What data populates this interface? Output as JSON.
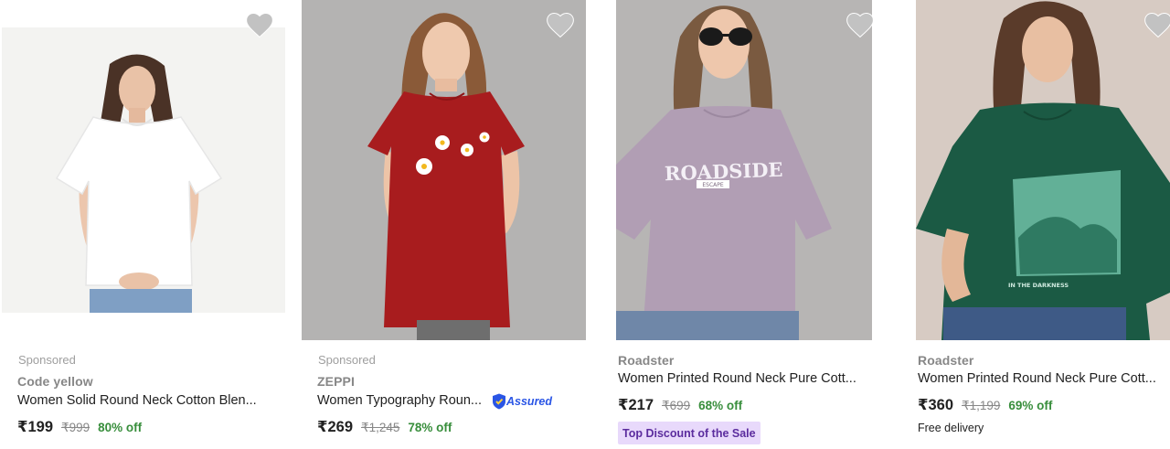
{
  "colors": {
    "discount_green": "#388e3c",
    "strike_grey": "#878787",
    "deal_bg": "#e8d9fb",
    "deal_text": "#5b2c9e",
    "assured_blue": "#2a55e5",
    "heart_grey": "#c2c2c2"
  },
  "products": [
    {
      "image": "white-tshirt-photo",
      "sponsored": "Sponsored",
      "brand": "Code yellow",
      "title": "Women Solid Round Neck Cotton Blen...",
      "price": "₹199",
      "mrp": "₹999",
      "off": "80% off",
      "wishlist_icon": "heart-icon"
    },
    {
      "image": "maroon-daisy-tshirt-photo",
      "sponsored": "Sponsored",
      "brand": "ZEPPI",
      "title": "Women Typography Roun...",
      "assured": "Assured",
      "price": "₹269",
      "mrp": "₹1,245",
      "off": "78% off",
      "wishlist_icon": "heart-icon"
    },
    {
      "image": "lavender-roadside-tshirt-photo",
      "brand": "Roadster",
      "title": "Women Printed Round Neck Pure Cott...",
      "price": "₹217",
      "mrp": "₹699",
      "off": "68% off",
      "badge": "Top Discount of the Sale",
      "print_text": "ROADSIDE",
      "print_sub": "ESCAPE",
      "wishlist_icon": "heart-icon"
    },
    {
      "image": "green-graphic-tshirt-photo",
      "brand": "Roadster",
      "title": "Women Printed Round Neck Pure Cott...",
      "price": "₹360",
      "mrp": "₹1,199",
      "off": "69% off",
      "delivery": "Free delivery",
      "print_text": "IN THE DARKNESS",
      "wishlist_icon": "heart-icon"
    }
  ]
}
